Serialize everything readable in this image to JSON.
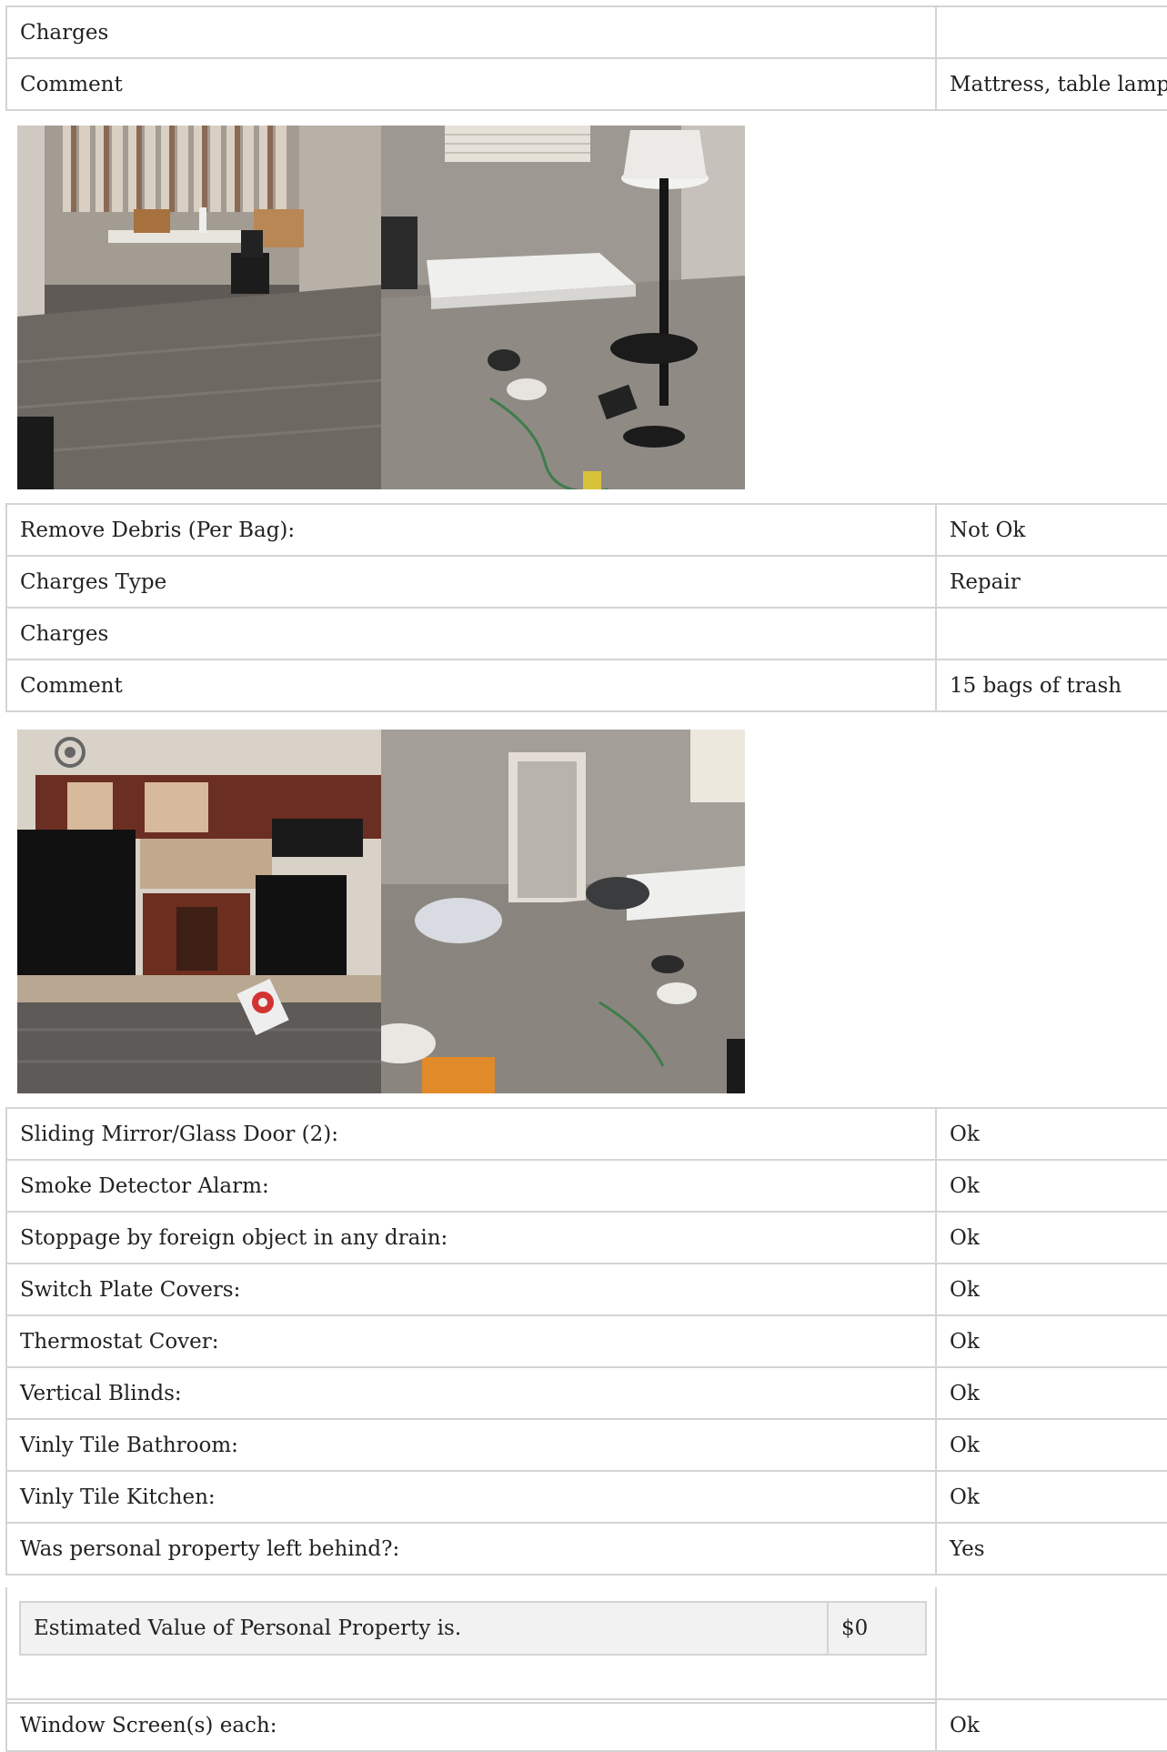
{
  "section1": {
    "rows": [
      {
        "label": "Charges",
        "value": ""
      },
      {
        "label": "Comment",
        "value": "Mattress, table lamp"
      }
    ]
  },
  "photos1": {
    "left_icon": "room-photo-table-icon",
    "right_icon": "room-photo-mattress-lamp-icon"
  },
  "section2": {
    "rows": [
      {
        "label": "Remove Debris (Per Bag):",
        "value": "Not Ok"
      },
      {
        "label": "Charges Type",
        "value": "Repair"
      },
      {
        "label": "Charges",
        "value": ""
      },
      {
        "label": "Comment",
        "value": "15 bags of trash"
      }
    ]
  },
  "photos2": {
    "left_icon": "kitchen-photo-icon",
    "right_icon": "bedroom-debris-photo-icon"
  },
  "section3": {
    "rows": [
      {
        "label": "Sliding Mirror/Glass Door (2):",
        "value": "Ok"
      },
      {
        "label": "Smoke Detector Alarm:",
        "value": "Ok"
      },
      {
        "label": "Stoppage by foreign object in any drain:",
        "value": "Ok"
      },
      {
        "label": "Switch Plate Covers:",
        "value": "Ok"
      },
      {
        "label": "Thermostat Cover:",
        "value": "Ok"
      },
      {
        "label": "Vertical Blinds:",
        "value": "Ok"
      },
      {
        "label": "Vinly Tile Bathroom:",
        "value": "Ok"
      },
      {
        "label": "Vinly Tile Kitchen:",
        "value": "Ok"
      },
      {
        "label": "Was personal property left behind?:",
        "value": "Yes"
      }
    ]
  },
  "personal_property": {
    "label": "Estimated Value of Personal Property is.",
    "value": "$0"
  },
  "section4": {
    "rows": [
      {
        "label": "Window Screen(s) each:",
        "value": "Ok"
      }
    ]
  }
}
